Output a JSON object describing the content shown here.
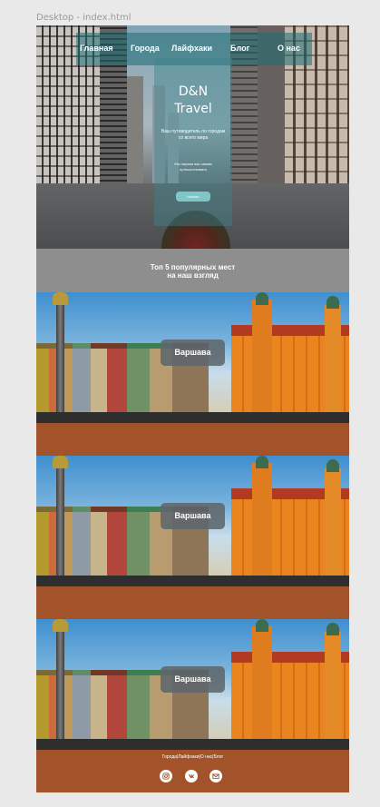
{
  "window": {
    "title": "Desktop - index.html"
  },
  "nav": {
    "items": [
      "Главная",
      "Города",
      "Лайфхаки",
      "Блог",
      "О нас"
    ]
  },
  "hero": {
    "title_line1": "D&N",
    "title_line2": "Travel",
    "subtitle": "Ваш путеводитель по городам со всего мира",
    "subtext": "Мы научим вас самим путешествовать",
    "button_label": "Начать"
  },
  "section": {
    "title_line1": "Топ 5 популярных мест",
    "title_line2": "на наш взгляд"
  },
  "cities": [
    {
      "button_label": "Варшава"
    },
    {
      "button_label": "Варшава"
    },
    {
      "button_label": "Варшава"
    }
  ],
  "footer": {
    "links": "Города|Лайфхаки|О нас|Блог",
    "social_icons": [
      "instagram-icon",
      "vk-icon",
      "mail-icon"
    ]
  },
  "colors": {
    "card_background": "#a3532a",
    "section_background": "#8e8e8e",
    "nav_background": "#1e6e73",
    "button_background": "#5f676c"
  }
}
